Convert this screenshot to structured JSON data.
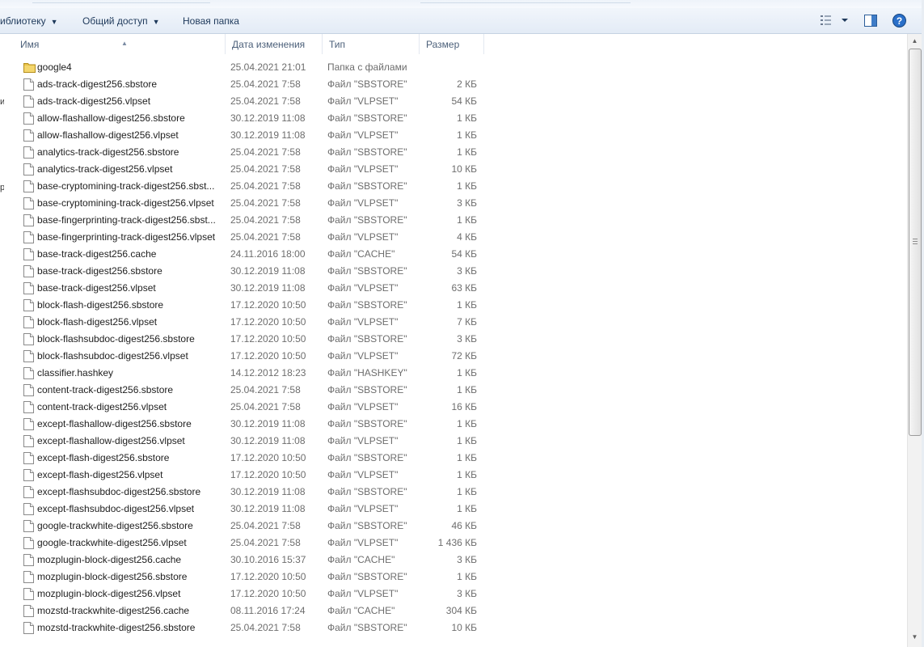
{
  "toolbar": {
    "library_label": "иблиотеку",
    "share_label": "Общий доступ",
    "new_folder_label": "Новая папка",
    "view_icon": "view-options-icon",
    "preview_icon": "preview-pane-icon",
    "help_icon": "help-icon",
    "help_glyph": "?"
  },
  "columns": {
    "name": "Имя",
    "date": "Дата изменения",
    "type": "Тип",
    "size": "Размер"
  },
  "colors": {
    "folder": "#e8c24a",
    "help": "#2a6fc9",
    "accent": "#1e395b"
  },
  "files": [
    {
      "name": "google4",
      "date": "25.04.2021 21:01",
      "type": "Папка с файлами",
      "size": "",
      "folder": true
    },
    {
      "name": "ads-track-digest256.sbstore",
      "date": "25.04.2021 7:58",
      "type": "Файл \"SBSTORE\"",
      "size": "2 КБ"
    },
    {
      "name": "ads-track-digest256.vlpset",
      "date": "25.04.2021 7:58",
      "type": "Файл \"VLPSET\"",
      "size": "54 КБ"
    },
    {
      "name": "allow-flashallow-digest256.sbstore",
      "date": "30.12.2019 11:08",
      "type": "Файл \"SBSTORE\"",
      "size": "1 КБ"
    },
    {
      "name": "allow-flashallow-digest256.vlpset",
      "date": "30.12.2019 11:08",
      "type": "Файл \"VLPSET\"",
      "size": "1 КБ"
    },
    {
      "name": "analytics-track-digest256.sbstore",
      "date": "25.04.2021 7:58",
      "type": "Файл \"SBSTORE\"",
      "size": "1 КБ"
    },
    {
      "name": "analytics-track-digest256.vlpset",
      "date": "25.04.2021 7:58",
      "type": "Файл \"VLPSET\"",
      "size": "10 КБ"
    },
    {
      "name": "base-cryptomining-track-digest256.sbst...",
      "date": "25.04.2021 7:58",
      "type": "Файл \"SBSTORE\"",
      "size": "1 КБ"
    },
    {
      "name": "base-cryptomining-track-digest256.vlpset",
      "date": "25.04.2021 7:58",
      "type": "Файл \"VLPSET\"",
      "size": "3 КБ"
    },
    {
      "name": "base-fingerprinting-track-digest256.sbst...",
      "date": "25.04.2021 7:58",
      "type": "Файл \"SBSTORE\"",
      "size": "1 КБ"
    },
    {
      "name": "base-fingerprinting-track-digest256.vlpset",
      "date": "25.04.2021 7:58",
      "type": "Файл \"VLPSET\"",
      "size": "4 КБ"
    },
    {
      "name": "base-track-digest256.cache",
      "date": "24.11.2016 18:00",
      "type": "Файл \"CACHE\"",
      "size": "54 КБ"
    },
    {
      "name": "base-track-digest256.sbstore",
      "date": "30.12.2019 11:08",
      "type": "Файл \"SBSTORE\"",
      "size": "3 КБ"
    },
    {
      "name": "base-track-digest256.vlpset",
      "date": "30.12.2019 11:08",
      "type": "Файл \"VLPSET\"",
      "size": "63 КБ"
    },
    {
      "name": "block-flash-digest256.sbstore",
      "date": "17.12.2020 10:50",
      "type": "Файл \"SBSTORE\"",
      "size": "1 КБ"
    },
    {
      "name": "block-flash-digest256.vlpset",
      "date": "17.12.2020 10:50",
      "type": "Файл \"VLPSET\"",
      "size": "7 КБ"
    },
    {
      "name": "block-flashsubdoc-digest256.sbstore",
      "date": "17.12.2020 10:50",
      "type": "Файл \"SBSTORE\"",
      "size": "3 КБ"
    },
    {
      "name": "block-flashsubdoc-digest256.vlpset",
      "date": "17.12.2020 10:50",
      "type": "Файл \"VLPSET\"",
      "size": "72 КБ"
    },
    {
      "name": "classifier.hashkey",
      "date": "14.12.2012 18:23",
      "type": "Файл \"HASHKEY\"",
      "size": "1 КБ"
    },
    {
      "name": "content-track-digest256.sbstore",
      "date": "25.04.2021 7:58",
      "type": "Файл \"SBSTORE\"",
      "size": "1 КБ"
    },
    {
      "name": "content-track-digest256.vlpset",
      "date": "25.04.2021 7:58",
      "type": "Файл \"VLPSET\"",
      "size": "16 КБ"
    },
    {
      "name": "except-flashallow-digest256.sbstore",
      "date": "30.12.2019 11:08",
      "type": "Файл \"SBSTORE\"",
      "size": "1 КБ"
    },
    {
      "name": "except-flashallow-digest256.vlpset",
      "date": "30.12.2019 11:08",
      "type": "Файл \"VLPSET\"",
      "size": "1 КБ"
    },
    {
      "name": "except-flash-digest256.sbstore",
      "date": "17.12.2020 10:50",
      "type": "Файл \"SBSTORE\"",
      "size": "1 КБ"
    },
    {
      "name": "except-flash-digest256.vlpset",
      "date": "17.12.2020 10:50",
      "type": "Файл \"VLPSET\"",
      "size": "1 КБ"
    },
    {
      "name": "except-flashsubdoc-digest256.sbstore",
      "date": "30.12.2019 11:08",
      "type": "Файл \"SBSTORE\"",
      "size": "1 КБ"
    },
    {
      "name": "except-flashsubdoc-digest256.vlpset",
      "date": "30.12.2019 11:08",
      "type": "Файл \"VLPSET\"",
      "size": "1 КБ"
    },
    {
      "name": "google-trackwhite-digest256.sbstore",
      "date": "25.04.2021 7:58",
      "type": "Файл \"SBSTORE\"",
      "size": "46 КБ"
    },
    {
      "name": "google-trackwhite-digest256.vlpset",
      "date": "25.04.2021 7:58",
      "type": "Файл \"VLPSET\"",
      "size": "1 436 КБ"
    },
    {
      "name": "mozplugin-block-digest256.cache",
      "date": "30.10.2016 15:37",
      "type": "Файл \"CACHE\"",
      "size": "3 КБ"
    },
    {
      "name": "mozplugin-block-digest256.sbstore",
      "date": "17.12.2020 10:50",
      "type": "Файл \"SBSTORE\"",
      "size": "1 КБ"
    },
    {
      "name": "mozplugin-block-digest256.vlpset",
      "date": "17.12.2020 10:50",
      "type": "Файл \"VLPSET\"",
      "size": "3 КБ"
    },
    {
      "name": "mozstd-trackwhite-digest256.cache",
      "date": "08.11.2016 17:24",
      "type": "Файл \"CACHE\"",
      "size": "304 КБ"
    },
    {
      "name": "mozstd-trackwhite-digest256.sbstore",
      "date": "25.04.2021 7:58",
      "type": "Файл \"SBSTORE\"",
      "size": "10 КБ"
    }
  ]
}
